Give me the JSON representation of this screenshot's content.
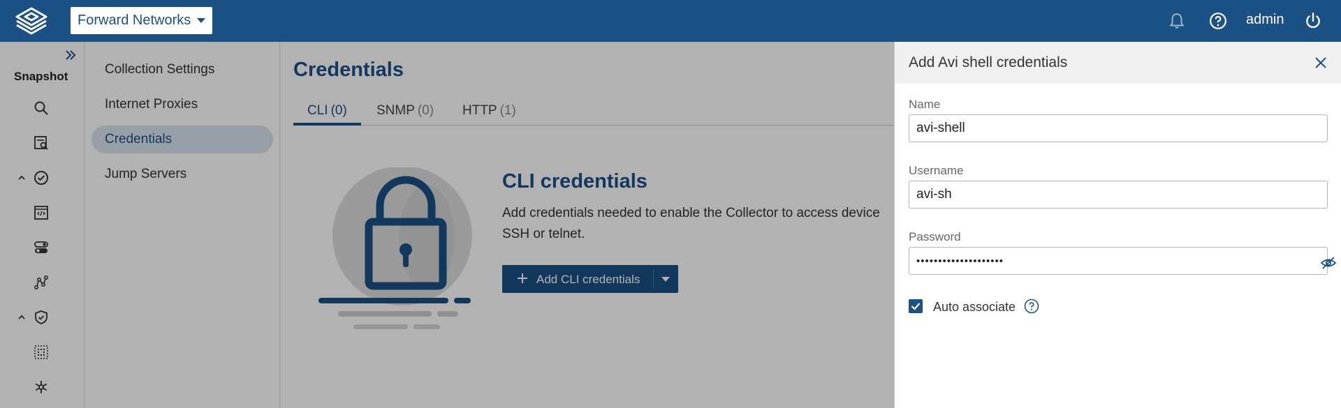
{
  "header": {
    "workspace": "Forward Networks",
    "user": "admin",
    "icons": [
      "logo-icon",
      "bell-icon",
      "help-circle-icon",
      "power-icon"
    ]
  },
  "rail": {
    "title": "Snapshot",
    "icons": [
      "search-icon",
      "snapshot-search-icon",
      "chevron-up-icon",
      "check-circle-icon",
      "code-window-icon",
      "toggle-icon",
      "graph-path-icon",
      "chevron-up-icon",
      "shield-check-icon",
      "grid-icon",
      "snowflake-icon"
    ]
  },
  "settings_nav": {
    "items": [
      {
        "label": "Collection Settings"
      },
      {
        "label": "Internet Proxies"
      },
      {
        "label": "Credentials"
      },
      {
        "label": "Jump Servers"
      }
    ],
    "active": "Credentials"
  },
  "main": {
    "title": "Credentials",
    "tabs": [
      {
        "label": "CLI",
        "count": "(0)"
      },
      {
        "label": "SNMP",
        "count": "(0)"
      },
      {
        "label": "HTTP",
        "count": "(1)"
      }
    ],
    "active_tab": "CLI",
    "empty_state": {
      "title": "CLI credentials",
      "description": "Add credentials needed to enable the Collector to access device\nSSH or telnet.",
      "button_label": "Add CLI credentials"
    }
  },
  "panel": {
    "title": "Add Avi shell credentials",
    "name_label": "Name",
    "name_value": "avi-shell",
    "username_label": "Username",
    "username_value": "avi-sh",
    "password_label": "Password",
    "password_value": "••••••••••••••••••••",
    "auto_associate_label": "Auto associate",
    "auto_associate_checked": true
  },
  "colors": {
    "brand": "#1c5186",
    "topbar": "#1c5186",
    "active_nav": "#dbe4ee",
    "panel_header": "#f0f0f0"
  }
}
